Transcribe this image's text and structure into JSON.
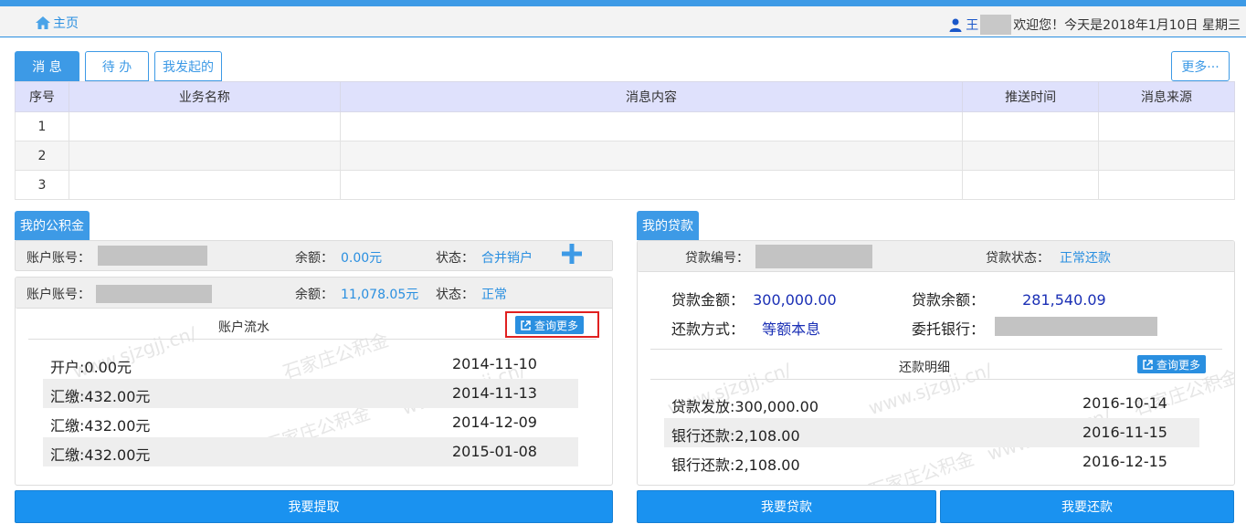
{
  "header": {
    "home_label": "主页",
    "username": "王",
    "welcome_text": "欢迎您！今天是2018年1月10日 星期三"
  },
  "tabs": [
    {
      "label": "消 息",
      "active": true
    },
    {
      "label": "待 办",
      "active": false
    },
    {
      "label": "我发起的",
      "active": false
    }
  ],
  "more_label": "更多···",
  "message_table": {
    "headers": [
      "序号",
      "业务名称",
      "消息内容",
      "推送时间",
      "消息来源"
    ],
    "rows": [
      [
        "1",
        "",
        "",
        "",
        ""
      ],
      [
        "2",
        "",
        "",
        "",
        ""
      ],
      [
        "3",
        "",
        "",
        "",
        ""
      ]
    ]
  },
  "fund": {
    "title": "我的公积金",
    "account_label": "账户账号：",
    "balance_label": "余额：",
    "status_label": "状态：",
    "accounts": [
      {
        "balance": "0.00元",
        "status": "合并销户"
      },
      {
        "balance": "11,078.05元",
        "status": "正常"
      }
    ],
    "flow_title": "账户流水",
    "query_more": "查询更多",
    "flows": [
      {
        "desc": "开户:0.00元",
        "date": "2014-11-10"
      },
      {
        "desc": "汇缴:432.00元",
        "date": "2014-11-13"
      },
      {
        "desc": "汇缴:432.00元",
        "date": "2014-12-09"
      },
      {
        "desc": "汇缴:432.00元",
        "date": "2015-01-08"
      }
    ],
    "withdraw_button": "我要提取"
  },
  "loan": {
    "title": "我的贷款",
    "number_label": "贷款编号：",
    "status_label": "贷款状态：",
    "status": "正常还款",
    "amount_label": "贷款金额：",
    "amount": "300,000.00",
    "balance_label": "贷款余额：",
    "balance": "281,540.09",
    "method_label": "还款方式：",
    "method": "等额本息",
    "bank_label": "委托银行：",
    "detail_title": "还款明细",
    "query_more": "查询更多",
    "details": [
      {
        "desc": "贷款发放:300,000.00",
        "date": "2016-10-14"
      },
      {
        "desc": "银行还款:2,108.00",
        "date": "2016-11-15"
      },
      {
        "desc": "银行还款:2,108.00",
        "date": "2016-12-15"
      }
    ],
    "loan_button": "我要贷款",
    "repay_button": "我要还款"
  },
  "watermarks": [
    "www.sjzgjj.cn/",
    "石家庄公积金"
  ],
  "colors": {
    "accent": "#3d9ae6",
    "link": "#2a8fe0",
    "value_blue": "#1a2fb5",
    "table_header": "#dfe1fc",
    "highlight": "#e02020"
  }
}
